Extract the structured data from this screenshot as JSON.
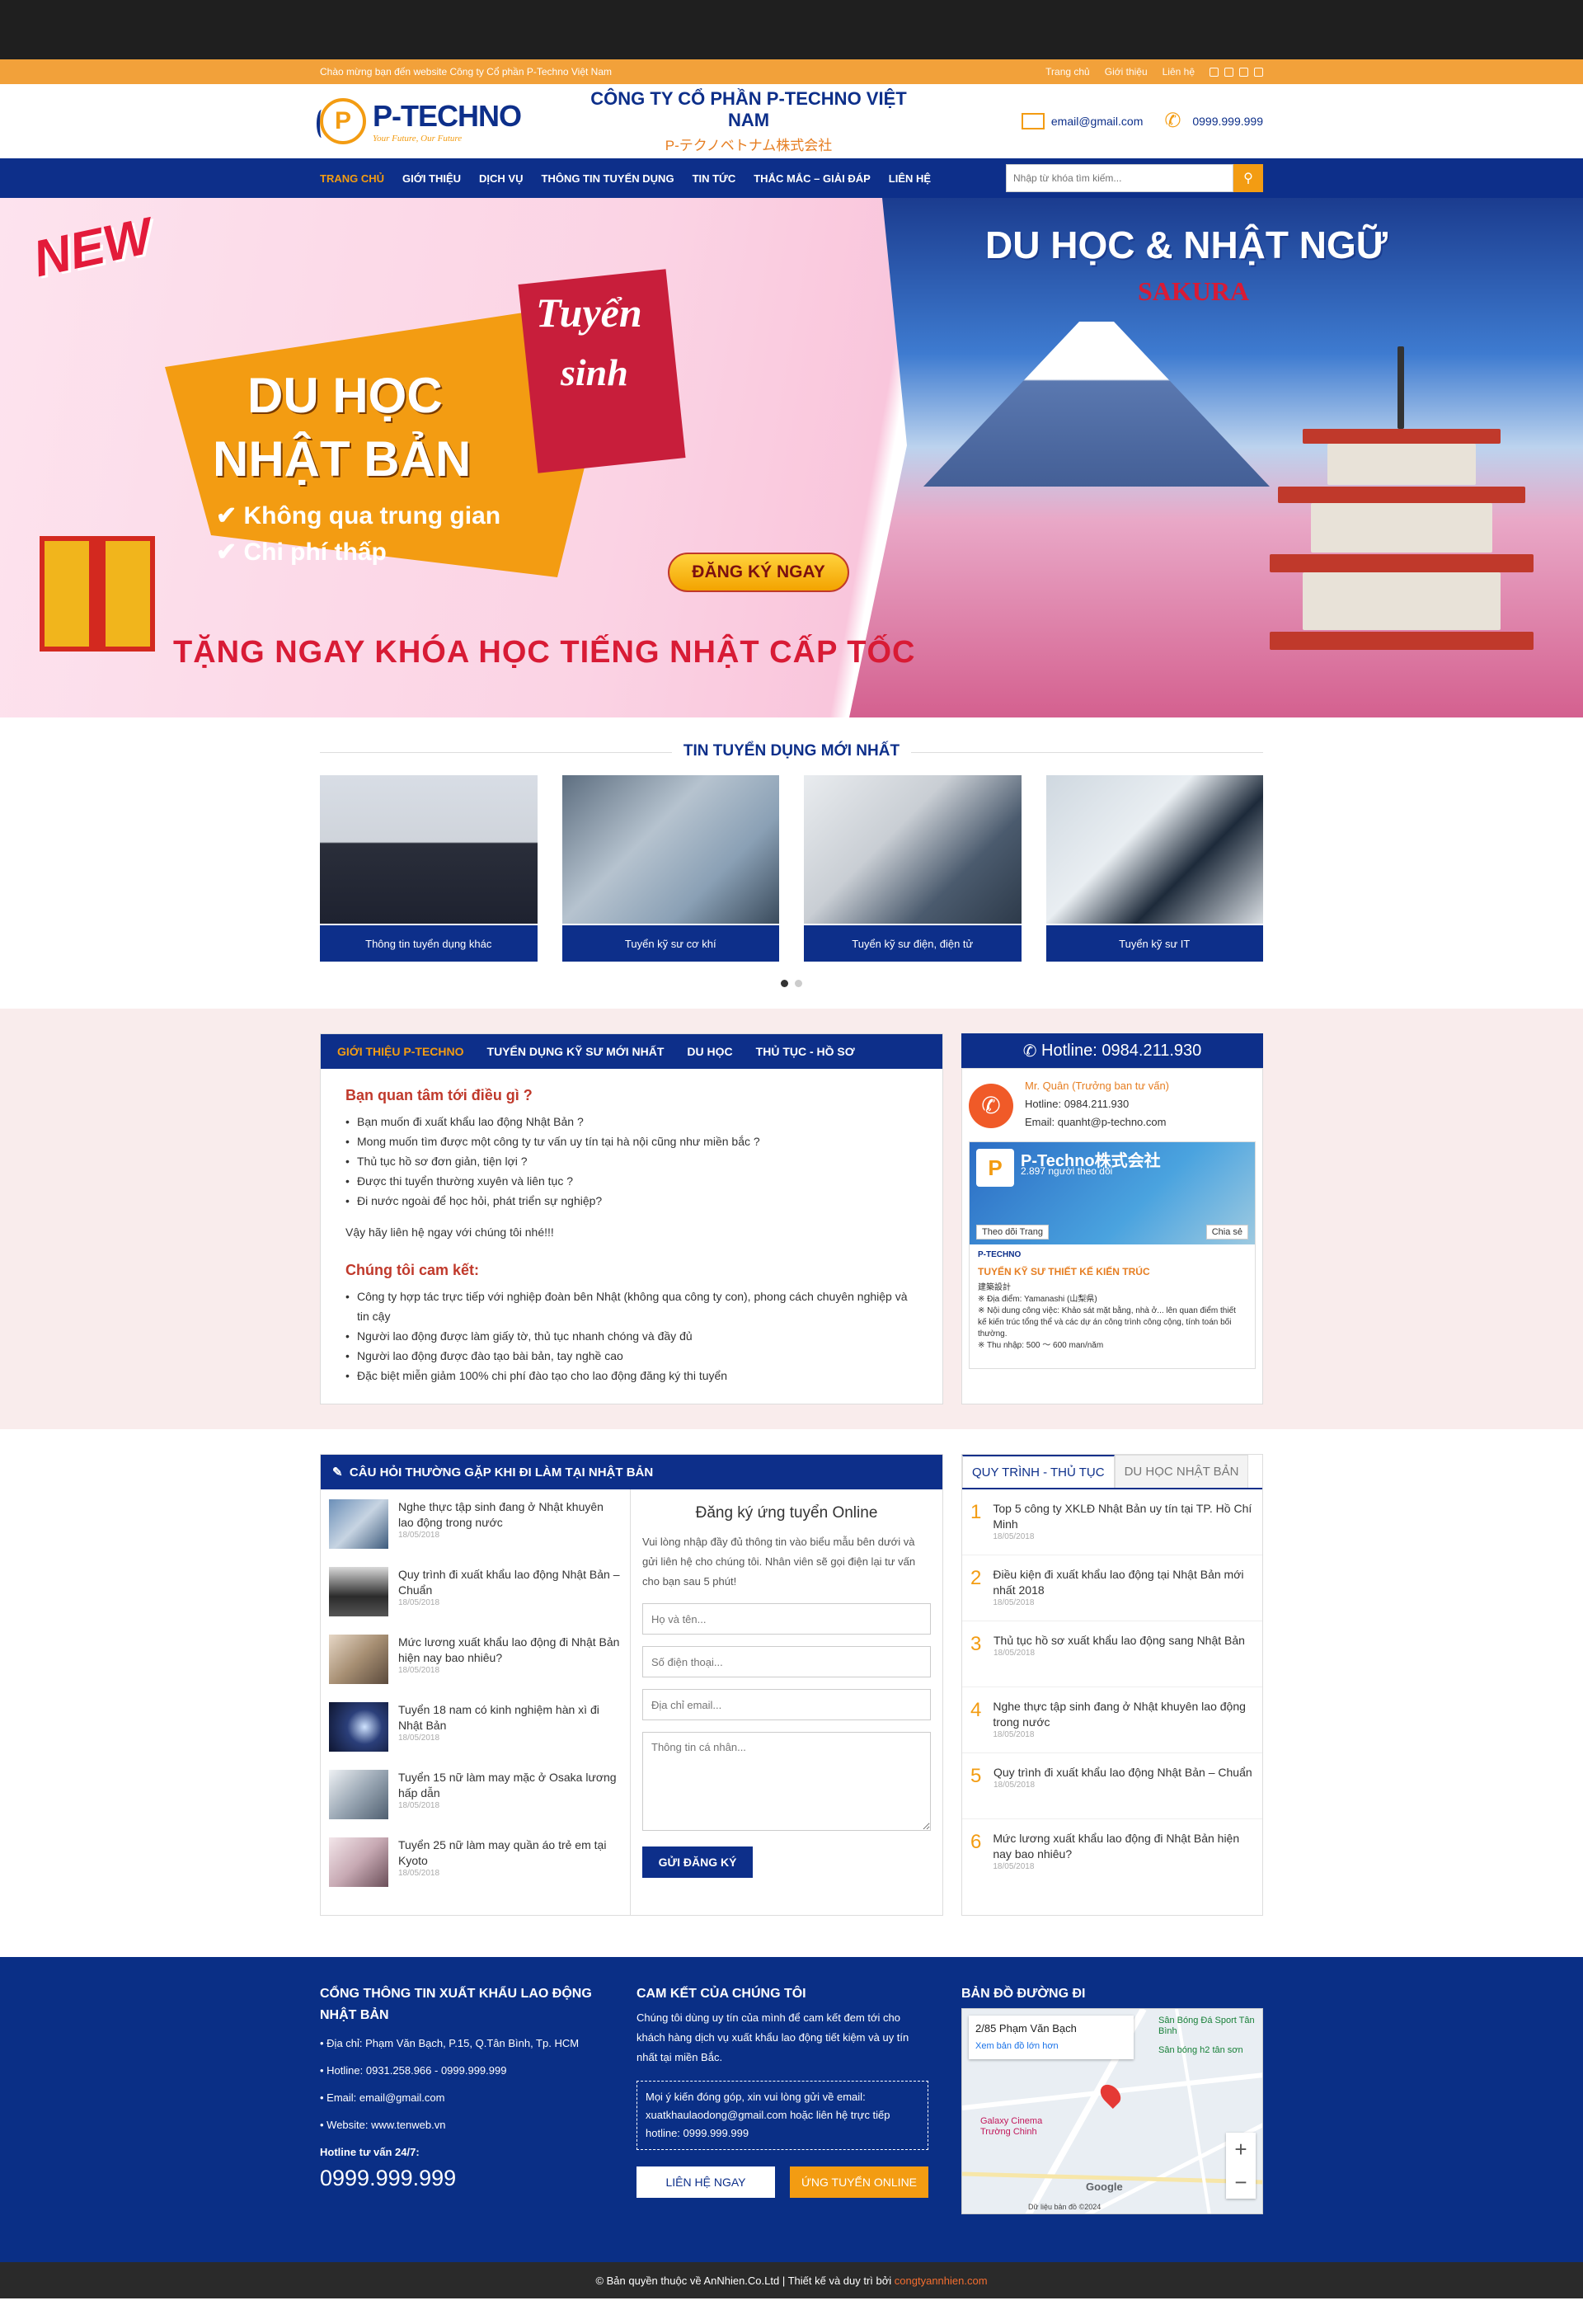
{
  "topbar": {
    "welcome": "Chào mừng bạn đến website Công ty Cổ phần P-Techno Việt Nam",
    "links": [
      "Trang chủ",
      "Giới thiệu",
      "Liên hệ"
    ]
  },
  "header": {
    "logo_text": "P-TECHNO",
    "logo_slogan": "Your Future, Our Future",
    "company_name": "CÔNG TY CỔ PHẦN P-TECHNO VIỆT NAM",
    "company_jp": "P-テクノベトナム株式会社",
    "email": "email@gmail.com",
    "phone": "0999.999.999"
  },
  "nav": {
    "items": [
      "TRANG CHỦ",
      "GIỚI THIỆU",
      "DỊCH VỤ",
      "THÔNG TIN TUYỂN DỤNG",
      "TIN TỨC",
      "THẮC MẮC – GIẢI ĐÁP",
      "LIÊN HỆ"
    ],
    "search_placeholder": "Nhập từ khóa tìm kiếm..."
  },
  "banner": {
    "new": "NEW",
    "title1": "DU HỌC",
    "title2": "NHẬT BẢN",
    "tuyen": "Tuyển",
    "sinh": "sinh",
    "check1": "Không qua trung gian",
    "check2": "Chi phí thấp",
    "register": "ĐĂNG KÝ NGAY",
    "promo": "TẶNG NGAY KHÓA HỌC TIẾNG NHẬT CẤP TỐC",
    "right_title": "DU HỌC & NHẬT NGỮ",
    "sakura": "SAKURA"
  },
  "jobs": {
    "title": "TIN TUYỂN DỤNG MỚI NHẤT",
    "cards": [
      "Thông tin tuyển dụng khác",
      "Tuyển kỹ sư cơ khí",
      "Tuyển kỹ sư điện, điện tử",
      "Tuyển kỹ sư IT"
    ]
  },
  "intro": {
    "tabs": [
      "GIỚI THIỆU P-TECHNO",
      "TUYỂN DỤNG KỸ SƯ MỚI NHẤT",
      "DU HỌC",
      "THỦ TỤC - HỒ SƠ"
    ],
    "q_title": "Bạn quan tâm tới điều gì ?",
    "questions": [
      "Bạn muốn đi xuất khẩu lao động Nhật Bản ?",
      "Mong muốn tìm được một công ty tư vấn uy tín tại hà nội cũng như miền bắc ?",
      "Thủ tục hồ sơ đơn giản, tiện lợi ?",
      "Được thi tuyển thường xuyên và liên tục ?",
      "Đi nước ngoài để học hỏi, phát triển sự nghiệp?"
    ],
    "call": "Vậy hãy liên hệ ngay với chúng tôi nhé!!!",
    "c_title": "Chúng tôi cam kết:",
    "commits": [
      "Công ty hợp tác trực tiếp với nghiệp đoàn bên Nhật (không qua công ty con), phong cách chuyên nghiệp và tin cậy",
      "Người lao động được làm giấy tờ, thủ tục nhanh chóng và đầy đủ",
      "Người lao động được đào tạo bài bản, tay nghề cao",
      "Đặc biệt miễn giảm 100% chi phí đào tạo cho lao động đăng ký thi tuyển"
    ]
  },
  "hotline": {
    "title": "Hotline: 0984.211.930",
    "name": "Mr. Quân (Trưởng ban tư vấn)",
    "phone": "Hotline: 0984.211.930",
    "email": "Email: quanht@p-techno.com",
    "fb_name": "P-Techno株式会社",
    "fb_followers": "2.897 người theo dõi",
    "fb_follow": "Theo dõi Trang",
    "fb_share": "Chia sẻ",
    "fb_post_title": "TUYỂN KỸ SƯ THIẾT KẾ KIẾN TRÚC",
    "fb_post_jp": "建築設計",
    "fb_post_lines": [
      "※ Địa điểm: Yamanashi (山梨県)",
      "※ Nội dung công việc: Khảo sát mặt bằng, nhà ở... lên quan điểm thiết kế kiến trúc tổng thể và các dự án công trình công cộng, tính toán bối thường.",
      "※ Thu nhập: 500 ～ 600 man/năm"
    ]
  },
  "faq": {
    "title": "CÂU HỎI THƯỜNG GẶP KHI ĐI LÀM TẠI NHẬT BẢN",
    "items": [
      {
        "t": "Nghe thực tập sinh đang ở Nhật khuyên lao động trong nước",
        "d": "18/05/2018"
      },
      {
        "t": "Quy trình đi xuất khẩu lao động Nhật Bản – Chuẩn",
        "d": "18/05/2018"
      },
      {
        "t": "Mức lương xuất khẩu lao động đi Nhật Bản hiện nay bao nhiêu?",
        "d": "18/05/2018"
      },
      {
        "t": "Tuyển 18 nam có kinh nghiệm hàn xì đi Nhật Bản",
        "d": "18/05/2018"
      },
      {
        "t": "Tuyển 15 nữ làm may mặc ở Osaka lương hấp dẫn",
        "d": "18/05/2018"
      },
      {
        "t": "Tuyển 25 nữ làm may quần áo trẻ em tại Kyoto",
        "d": "18/05/2018"
      }
    ]
  },
  "form": {
    "title": "Đăng ký ứng tuyển Online",
    "desc": "Vui lòng nhập đầy đủ thông tin vào biểu mẫu bên dưới và gửi liên hệ cho chúng tôi. Nhân viên sẽ gọi điện lại tư vấn cho bạn sau 5 phút!",
    "ph_name": "Họ và tên...",
    "ph_phone": "Số điện thoại...",
    "ph_email": "Địa chỉ email...",
    "ph_info": "Thông tin cá nhân...",
    "submit": "GỬI ĐĂNG KÝ"
  },
  "proc": {
    "tabs": [
      "QUY TRÌNH - THỦ TỤC",
      "DU HỌC NHẬT BẢN"
    ],
    "items": [
      {
        "n": "1",
        "t": "Top 5 công ty XKLĐ Nhật Bản uy tín tại TP. Hồ Chí Minh",
        "d": "18/05/2018"
      },
      {
        "n": "2",
        "t": "Điều kiện đi xuất khẩu lao động tại Nhật Bản mới nhất 2018",
        "d": "18/05/2018"
      },
      {
        "n": "3",
        "t": "Thủ tục hồ sơ xuất khẩu lao động sang Nhật Bản",
        "d": "18/05/2018"
      },
      {
        "n": "4",
        "t": "Nghe thực tập sinh đang ở Nhật khuyên lao động trong nước",
        "d": "18/05/2018"
      },
      {
        "n": "5",
        "t": "Quy trình đi xuất khẩu lao động Nhật Bản – Chuẩn",
        "d": "18/05/2018"
      },
      {
        "n": "6",
        "t": "Mức lương xuất khẩu lao động đi Nhật Bản hiện nay bao nhiêu?",
        "d": "18/05/2018"
      }
    ]
  },
  "footer": {
    "c1_title": "CỔNG THÔNG TIN XUẤT KHẨU LAO ĐỘNG NHẬT BẢN",
    "address": "Địa chỉ: Phạm Văn Bạch, P.15, Q.Tân Bình, Tp. HCM",
    "hotline": "Hotline: 0931.258.966 - 0999.999.999",
    "email": "Email: email@gmail.com",
    "website": "Website: www.tenweb.vn",
    "hot247": "Hotline tư vấn 24/7:",
    "bignum": "0999.999.999",
    "c2_title": "CAM KẾT CỦA CHÚNG TÔI",
    "c2_text": "Chúng tôi dùng uy tín của mình để cam kết đem tới cho khách hàng dịch vụ xuất khẩu lao động tiết kiệm và uy tín nhất tại miền Bắc.",
    "note": "Mọi ý kiến đóng góp, xin vui lòng gửi về email: xuatkhaulaodong@gmail.com hoặc liên hệ trực tiếp hotline: 0999.999.999",
    "btn_contact": "LIÊN HỆ NGAY",
    "btn_apply": "ỨNG TUYỂN ONLINE",
    "c3_title": "BẢN ĐỒ ĐƯỜNG ĐI",
    "map_addr": "2/85 Phạm Văn Bạch",
    "map_link": "Xem bản đồ lớn hơn",
    "map_place1": "Sân Bóng Đá Sport Tân Bình",
    "map_place2": "Sân bóng h2 tân sơn",
    "map_place3": "Galaxy Cinema Trường Chinh",
    "map_google": "Google",
    "map_credit": "Dữ liệu bản đồ ©2024"
  },
  "copyright": {
    "text": "© Bản quyền thuộc về AnNhien.Co.Ltd  |  Thiết kế và duy trì bởi ",
    "link": "congtyannhien.com"
  },
  "colors": {
    "primary": "#0d2f8a",
    "accent": "#f39c12",
    "red": "#c0392b"
  }
}
